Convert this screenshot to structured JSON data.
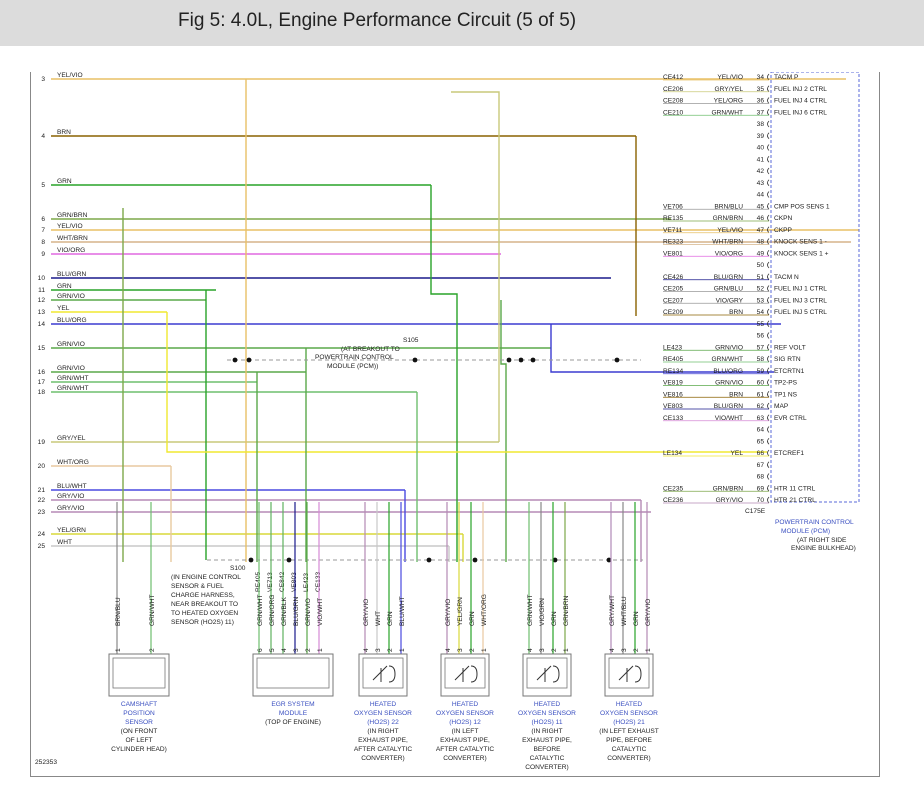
{
  "title": "Fig 5: 4.0L, Engine Performance Circuit (5 of 5)",
  "figure_id": "252353",
  "colors": {
    "YEL/VIO": "#e8c066",
    "BRN": "#8a6200",
    "GRN": "#29a329",
    "GRN/BRN": "#7da84a",
    "YEL/VIO2": "#d9c24e",
    "WHT/BRN": "#d6b48a",
    "VIO/ORG": "#e069e0",
    "BLU/GRN": "#1a1a8c",
    "GRN/VIO": "#5aa84a",
    "YEL": "#f0e830",
    "BLU/ORG": "#3b3bd1",
    "GRN/WHT": "#6fbf6f",
    "GRY/YEL": "#c9c97a",
    "WHT/ORG": "#e8c9a0",
    "BLU/WHT": "#4a4ae0",
    "GRY/VIO": "#b58ab5",
    "YEL/GRN": "#d8d83a",
    "WHT": "#c8c8c8",
    "VIO/WHT": "#d58ad5",
    "GRY": "#8c8cc8"
  },
  "left_wires": [
    {
      "num": "3",
      "color": "YEL/VIO"
    },
    {
      "num": "4",
      "color": "BRN"
    },
    {
      "num": "5",
      "color": "GRN"
    },
    {
      "num": "6",
      "color": "GRN/BRN"
    },
    {
      "num": "7",
      "color": "YEL/VIO"
    },
    {
      "num": "8",
      "color": "WHT/BRN"
    },
    {
      "num": "9",
      "color": "VIO/ORG"
    },
    {
      "num": "10",
      "color": "BLU/GRN"
    },
    {
      "num": "11",
      "color": "GRN"
    },
    {
      "num": "12",
      "color": "GRN/VIO"
    },
    {
      "num": "13",
      "color": "YEL"
    },
    {
      "num": "14",
      "color": "BLU/ORG"
    },
    {
      "num": "15",
      "color": "GRN/VIO"
    },
    {
      "num": "16",
      "color": "GRN/VIO"
    },
    {
      "num": "17",
      "color": "GRN/WHT"
    },
    {
      "num": "18",
      "color": "GRN/WHT"
    },
    {
      "num": "19",
      "color": "GRY/YEL"
    },
    {
      "num": "20",
      "color": "WHT/ORG"
    },
    {
      "num": "21",
      "color": "BLU/WHT"
    },
    {
      "num": "22",
      "color": "GRY/VIO"
    },
    {
      "num": "23",
      "color": "GRY/VIO"
    },
    {
      "num": "24",
      "color": "YEL/GRN"
    },
    {
      "num": "25",
      "color": "WHT"
    }
  ],
  "pcm_pins": [
    {
      "code": "CE412",
      "color": "YEL/VIO",
      "pin": "34",
      "name": "TACM P"
    },
    {
      "code": "CE206",
      "color": "GRY/YEL",
      "pin": "35",
      "name": "FUEL INJ 2 CTRL"
    },
    {
      "code": "CE208",
      "color": "YEL/ORG",
      "pin": "36",
      "name": "FUEL INJ 4 CTRL"
    },
    {
      "code": "CE210",
      "color": "GRN/WHT",
      "pin": "37",
      "name": "FUEL INJ 6 CTRL"
    },
    {
      "code": "",
      "color": "",
      "pin": "38",
      "name": ""
    },
    {
      "code": "",
      "color": "",
      "pin": "39",
      "name": ""
    },
    {
      "code": "",
      "color": "",
      "pin": "40",
      "name": ""
    },
    {
      "code": "",
      "color": "",
      "pin": "41",
      "name": ""
    },
    {
      "code": "",
      "color": "",
      "pin": "42",
      "name": ""
    },
    {
      "code": "",
      "color": "",
      "pin": "43",
      "name": ""
    },
    {
      "code": "",
      "color": "",
      "pin": "44",
      "name": ""
    },
    {
      "code": "VE706",
      "color": "BRN/BLU",
      "pin": "45",
      "name": "CMP POS SENS 1"
    },
    {
      "code": "RE135",
      "color": "GRN/BRN",
      "pin": "46",
      "name": "CKPN"
    },
    {
      "code": "VE711",
      "color": "YEL/VIO",
      "pin": "47",
      "name": "CKPP"
    },
    {
      "code": "RE323",
      "color": "WHT/BRN",
      "pin": "48",
      "name": "KNOCK SENS 1 -"
    },
    {
      "code": "VE801",
      "color": "VIO/ORG",
      "pin": "49",
      "name": "KNOCK SENS 1 +"
    },
    {
      "code": "",
      "color": "",
      "pin": "50",
      "name": ""
    },
    {
      "code": "CE426",
      "color": "BLU/GRN",
      "pin": "51",
      "name": "TACM N"
    },
    {
      "code": "CE205",
      "color": "GRN/BLU",
      "pin": "52",
      "name": "FUEL INJ 1 CTRL"
    },
    {
      "code": "CE207",
      "color": "VIO/GRY",
      "pin": "53",
      "name": "FUEL INJ 3 CTRL"
    },
    {
      "code": "CE209",
      "color": "BRN",
      "pin": "54",
      "name": "FUEL INJ 5 CTRL"
    },
    {
      "code": "",
      "color": "",
      "pin": "55",
      "name": ""
    },
    {
      "code": "",
      "color": "",
      "pin": "56",
      "name": ""
    },
    {
      "code": "LE423",
      "color": "GRN/VIO",
      "pin": "57",
      "name": "REF VOLT"
    },
    {
      "code": "RE405",
      "color": "GRN/WHT",
      "pin": "58",
      "name": "SIG RTN"
    },
    {
      "code": "RE134",
      "color": "BLU/ORG",
      "pin": "59",
      "name": "ETCRTN1"
    },
    {
      "code": "VE819",
      "color": "GRN/VIO",
      "pin": "60",
      "name": "TP2-PS"
    },
    {
      "code": "VE816",
      "color": "BRN",
      "pin": "61",
      "name": "TP1 NS"
    },
    {
      "code": "VE803",
      "color": "BLU/GRN",
      "pin": "62",
      "name": "MAP"
    },
    {
      "code": "CE133",
      "color": "VIO/WHT",
      "pin": "63",
      "name": "EVR CTRL"
    },
    {
      "code": "",
      "color": "",
      "pin": "64",
      "name": ""
    },
    {
      "code": "",
      "color": "",
      "pin": "65",
      "name": ""
    },
    {
      "code": "LE134",
      "color": "YEL",
      "pin": "66",
      "name": "ETCREF1"
    },
    {
      "code": "",
      "color": "",
      "pin": "67",
      "name": ""
    },
    {
      "code": "",
      "color": "",
      "pin": "68",
      "name": ""
    },
    {
      "code": "CE235",
      "color": "GRN/BRN",
      "pin": "69",
      "name": "HTR 11 CTRL"
    },
    {
      "code": "CE236",
      "color": "GRY/VIO",
      "pin": "70",
      "name": "HTR 21 CTRL"
    }
  ],
  "pcm": {
    "connector": "C175E",
    "label_1": "POWERTRAIN CONTROL",
    "label_2": "MODULE (PCM)",
    "note_1": "(AT RIGHT SIDE",
    "note_2": "ENGINE BULKHEAD)"
  },
  "s105": {
    "id": "S105",
    "l1": "(AT BREAKOUT TO",
    "l2": "POWERTRAIN CONTROL",
    "l3": "MODULE (PCM))"
  },
  "s100": {
    "id": "S100",
    "l1": "(IN ENGINE CONTROL",
    "l2": "SENSOR & FUEL",
    "l3": "CHARGE HARNESS,",
    "l4": "NEAR BREAKOUT TO",
    "l5": "TO HEATED OXYGEN",
    "l6": "SENSOR (HO2S) 11)"
  },
  "egr_codes": [
    "RE405",
    "VE713",
    "CE842",
    "VE803",
    "LE423",
    "CE133"
  ],
  "components": [
    {
      "pins": [
        {
          "n": "1",
          "w": "BRN/BLU"
        },
        {
          "n": "2",
          "w": "GRN/WHT"
        }
      ],
      "label": [
        "CAMSHAFT",
        "POSITION",
        "SENSOR",
        "(ON FRONT",
        "OF LEFT",
        "CYLINDER HEAD)"
      ]
    },
    {
      "pins": [
        {
          "n": "6",
          "w": "GRN/WHT"
        },
        {
          "n": "5",
          "w": "GRN/ORG"
        },
        {
          "n": "4",
          "w": "GRN/BLK"
        },
        {
          "n": "3",
          "w": "BLU/GRN"
        },
        {
          "n": "2",
          "w": "GRN/VIO"
        },
        {
          "n": "1",
          "w": "VIO/WHT"
        }
      ],
      "label": [
        "EGR SYSTEM",
        "MODULE",
        "(TOP OF ENGINE)"
      ]
    },
    {
      "pins": [
        {
          "n": "4",
          "w": "GRY/VIO"
        },
        {
          "n": "3",
          "w": "WHT"
        },
        {
          "n": "2",
          "w": "GRN"
        },
        {
          "n": "1",
          "w": "BLU/WHT"
        }
      ],
      "label": [
        "HEATED",
        "OXYGEN SENSOR",
        "(HO2S) 22",
        "(IN RIGHT",
        "EXHAUST PIPE,",
        "AFTER CATALYTIC",
        "CONVERTER)"
      ]
    },
    {
      "pins": [
        {
          "n": "4",
          "w": "GRY/VIO"
        },
        {
          "n": "3",
          "w": "YEL/GRN"
        },
        {
          "n": "2",
          "w": "GRN"
        },
        {
          "n": "1",
          "w": "WHT/ORG"
        }
      ],
      "label": [
        "HEATED",
        "OXYGEN SENSOR",
        "(HO2S) 12",
        "(IN LEFT",
        "EXHAUST PIPE,",
        "AFTER CATALYTIC",
        "CONVERTER)"
      ]
    },
    {
      "pins": [
        {
          "n": "4",
          "w": "GRN/WHT"
        },
        {
          "n": "3",
          "w": "VIO/GRN"
        },
        {
          "n": "2",
          "w": "GRN"
        },
        {
          "n": "1",
          "w": "GRN/BRN"
        }
      ],
      "label": [
        "HEATED",
        "OXYGEN SENSOR",
        "(HO2S) 11",
        "(IN RIGHT",
        "EXHAUST PIPE,",
        "BEFORE",
        "CATALYTIC",
        "CONVERTER)"
      ]
    },
    {
      "pins": [
        {
          "n": "4",
          "w": "GRY/WHT"
        },
        {
          "n": "3",
          "w": "WHT/BLU"
        },
        {
          "n": "2",
          "w": "GRN"
        },
        {
          "n": "1",
          "w": "GRY/VIO"
        }
      ],
      "label": [
        "HEATED",
        "OXYGEN SENSOR",
        "(HO2S) 21",
        "(IN LEFT EXHAUST",
        "PIPE, BEFORE",
        "CATALYTIC",
        "CONVERTER)"
      ]
    }
  ]
}
